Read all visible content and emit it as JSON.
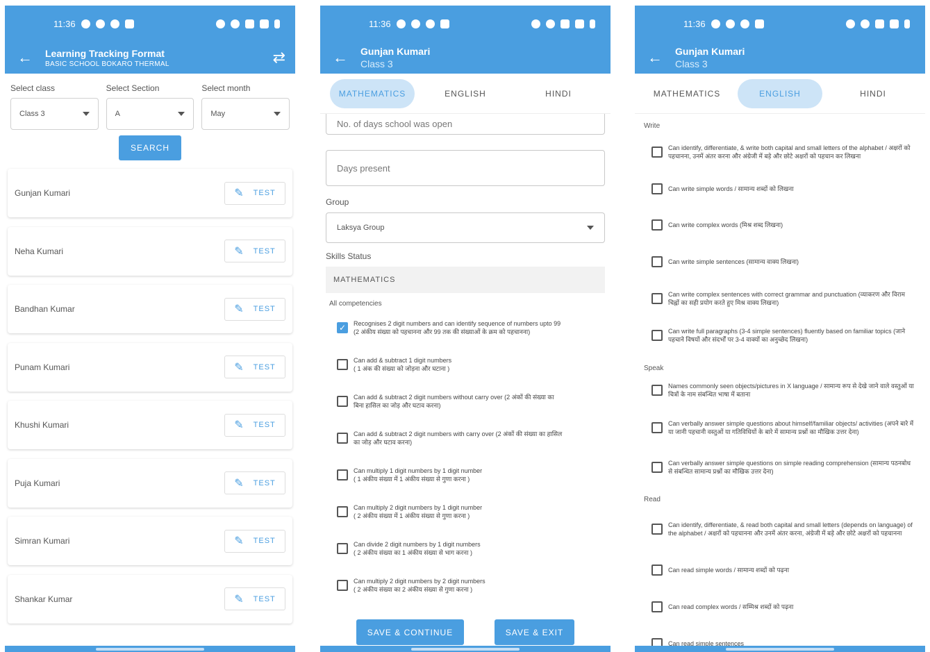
{
  "status_bar": {
    "time": "11:36"
  },
  "screen1": {
    "title": "Learning Tracking Format",
    "subtitle": "BASIC SCHOOL BOKARO THERMAL",
    "filters": [
      {
        "label": "Select class",
        "value": "Class 3"
      },
      {
        "label": "Select Section",
        "value": "A"
      },
      {
        "label": "Select month",
        "value": "May"
      }
    ],
    "search_label": "SEARCH",
    "test_label": "TEST",
    "students": [
      "Gunjan Kumari",
      "Neha Kumari",
      "Bandhan Kumar",
      "Punam Kumari",
      "Khushi Kumari",
      "Puja Kumari",
      "Simran Kumari",
      "Shankar Kumar"
    ]
  },
  "screen2": {
    "title": "Gunjan Kumari",
    "subtitle": "Class 3",
    "tabs": [
      "MATHEMATICS",
      "ENGLISH",
      "HINDI"
    ],
    "active_tab": "MATHEMATICS",
    "school_open_placeholder": "No. of days school was open",
    "days_present_placeholder": "Days present",
    "group_label": "Group",
    "group_value": "Laksya Group",
    "skills_label": "Skills Status",
    "subject_header": "MATHEMATICS",
    "all_competencies": "All competencies",
    "competencies": [
      {
        "text": "Recognises 2 digit numbers and can identify sequence of numbers upto 99",
        "hindi": "(2 अंकीय संख्या को पहचानना और 99 तक की संख्याओं के क्रम को पहचानना)",
        "checked": true
      },
      {
        "text": "Can add & subtract 1 digit numbers",
        "hindi": "( 1 अंक की संख्या को जोड़ना और घटाना )",
        "checked": false
      },
      {
        "text": "Can add & subtract 2 digit numbers without carry over (2 अंकों की संख्या का",
        "hindi": "बिना हासिल का जोड़ और घटाव करना)",
        "checked": false
      },
      {
        "text": "Can add & subtract 2 digit numbers with carry over (2 अंकों की संख्या का हासिल",
        "hindi": "का जोड़ और घटाव करना)",
        "checked": false
      },
      {
        "text": "Can multiply 1 digit numbers by 1 digit number",
        "hindi": "( 1 अंकीय संख्या में 1 अंकीय संख्या से गुणा करना )",
        "checked": false
      },
      {
        "text": "Can multiply 2 digit numbers by 1 digit number",
        "hindi": "( 2 अंकीय संख्या में 1 अंकीय संख्या से गुणा करना )",
        "checked": false
      },
      {
        "text": "Can divide 2 digit numbers by 1 digit numbers",
        "hindi": "( 2 अंकीय संख्या का 1 अंकीय संख्या से भाग करना )",
        "checked": false
      },
      {
        "text": "Can multiply 2 digit numbers by 2 digit numbers",
        "hindi": "( 2 अंकीय संख्या का 2 अंकीय संख्या से गुणा करना )",
        "checked": false
      }
    ],
    "save_continue": "SAVE & CONTINUE",
    "save_exit": "SAVE & EXIT"
  },
  "screen3": {
    "title": "Gunjan Kumari",
    "subtitle": "Class 3",
    "tabs": [
      "MATHEMATICS",
      "ENGLISH",
      "HINDI"
    ],
    "active_tab": "ENGLISH",
    "groups": [
      {
        "name": "Write",
        "items": [
          "Can identify, differentiate, & write both capital and small letters of the alphabet / अक्षरों को पहचानना, उनमें अंतर करना और अंग्रेजी में बड़े और छोटे अक्षरों को पहचान कर लिखना",
          "Can write simple words / सामान्य शब्दों को लिखना",
          "Can write complex words (मिश्र शब्द लिखना)",
          "Can write simple sentences (सामान्य वाक्य लिखना)",
          "Can write complex sentences with correct grammar and punctuation (व्याकरण और विराम चिह्नों का सही प्रयोग करते हुए मिश्र वाक्य लिखना)",
          "Can write full paragraphs (3-4 simple sentences) fluently based on familiar topics (जाने पहचाने विषयों और संदर्भों पर 3-4 वाक्यों का अनुच्छेद लिखना)"
        ]
      },
      {
        "name": "Speak",
        "items": [
          "Names commonly seen objects/pictures in X language / सामान्य रूप से देखे जाने वाले वस्तुओं या चित्रों के नाम संबन्धित भाषा में बताना",
          "Can verbally answer simple questions about himself/familiar objects/ activities (अपने बारे में या जानी पहचानी वस्तुओं या गतिविधियों के बारे में सामान्य प्रश्नों का मौखिक उत्तर देना)",
          "Can verbally answer simple questions on simple reading comprehension (सामान्य पठनबोध से संबन्धित सामान्य प्रश्नों का मौखिक उत्तर देना)"
        ]
      },
      {
        "name": "Read",
        "items": [
          "Can identify, differentiate, & read both capital and small letters (depends on language) of the alphabet / अक्षरों को पहचानना और उनमें अंतर करना, अंग्रेजी में बड़े और छोटे अक्षरों को पहचानना",
          "Can read simple words / सामान्य शब्दों को पढ़ना",
          "Can read complex words / सम्मिश्र शब्दों को पढ़ना",
          "Can read simple sentences"
        ]
      }
    ]
  },
  "colors": {
    "primary": "#4a9ee0",
    "tab_active_bg": "#cde4f7"
  },
  "icons": [
    "back-arrow-icon",
    "sync-icon",
    "edit-icon",
    "dropdown-caret-icon",
    "checkbox-icon"
  ]
}
